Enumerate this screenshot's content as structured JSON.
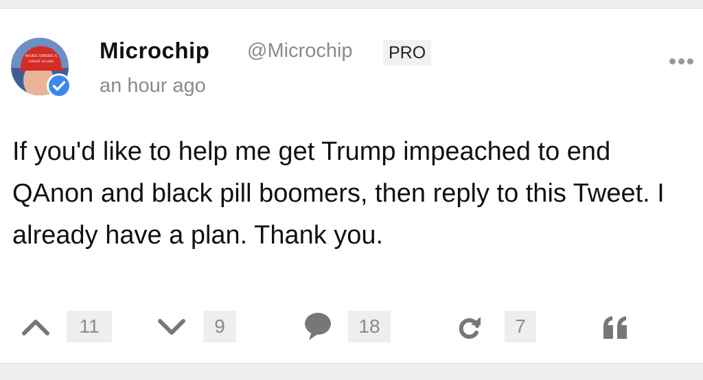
{
  "post": {
    "author_name": "Microchip",
    "handle": "@Microchip",
    "badge": "PRO",
    "timestamp": "an hour ago",
    "text": "If you'd like to help me get Trump impeached to end QAnon and black pill boomers, then reply to this Tweet. I already have a plan. Thank you.",
    "avatar_hat_text": [
      "MAKE AMERICA",
      "GREAT AGAIN"
    ]
  },
  "actions": {
    "upvotes": "11",
    "downvotes": "9",
    "comments": "18",
    "reposts": "7"
  },
  "icons": {
    "more": "more-dots-icon",
    "upvote": "chevron-up-icon",
    "downvote": "chevron-down-icon",
    "comment": "speech-bubble-icon",
    "repost": "refresh-icon",
    "quote": "quote-icon",
    "verified": "verified-check-icon"
  },
  "colors": {
    "verified_blue": "#3b88f0",
    "icon_gray": "#777777",
    "hat_red": "#d42b25"
  }
}
